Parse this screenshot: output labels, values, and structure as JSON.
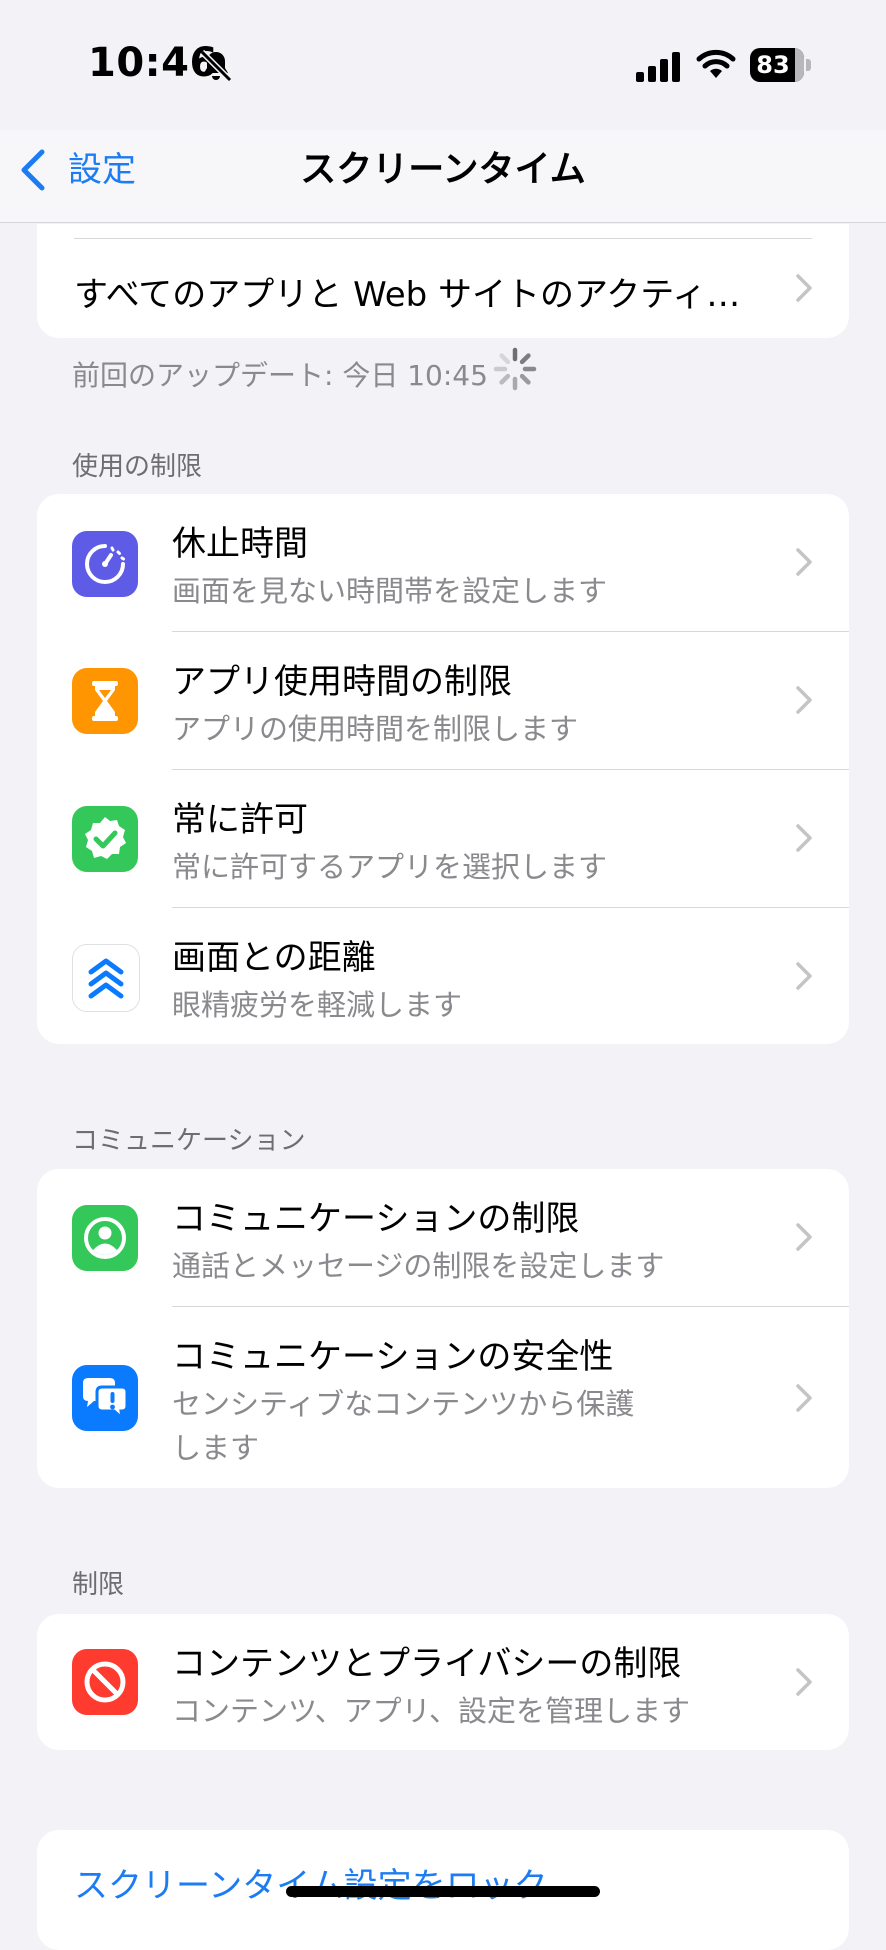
{
  "status_bar": {
    "time": "10:46",
    "battery": "83",
    "icons": [
      "bell-slash-icon",
      "signal-icon",
      "wifi-icon",
      "battery-icon"
    ]
  },
  "nav": {
    "back_label": "設定",
    "title": "スクリーンタイム"
  },
  "activity": {
    "label": "すべてのアプリと Web サイトのアクティ…",
    "update": "前回のアップデート: 今日 10:45"
  },
  "sections": {
    "limits": {
      "header": "使用の制限",
      "items": [
        {
          "title": "休止時間",
          "subtitle": "画面を見ない時間帯を設定します",
          "icon": "downtime-icon",
          "color": "#5E5CE6"
        },
        {
          "title": "アプリ使用時間の制限",
          "subtitle": "アプリの使用時間を制限します",
          "icon": "hourglass-icon",
          "color": "#FF9500"
        },
        {
          "title": "常に許可",
          "subtitle": "常に許可するアプリを選択します",
          "icon": "checkmark-seal-icon",
          "color": "#34C759"
        },
        {
          "title": "画面との距離",
          "subtitle": "眼精疲労を軽減します",
          "icon": "chevrons-up-icon",
          "color": "#FFFFFF"
        }
      ]
    },
    "communication": {
      "header": "コミュニケーション",
      "items": [
        {
          "title": "コミュニケーションの制限",
          "subtitle": "通話とメッセージの制限を設定します",
          "icon": "person-circle-icon",
          "color": "#34C759"
        },
        {
          "title": "コミュニケーションの安全性",
          "subtitle_line1": "センシティブなコンテンツから保護",
          "subtitle_line2": "します",
          "icon": "chat-bubbles-exclamation-icon",
          "color": "#0A7AFF"
        }
      ]
    },
    "restrictions": {
      "header": "制限",
      "items": [
        {
          "title": "コンテンツとプライバシーの制限",
          "subtitle": "コンテンツ、アプリ、設定を管理します",
          "icon": "prohibited-icon",
          "color": "#FF3B30"
        }
      ]
    }
  },
  "lock": {
    "label": "スクリーンタイム設定をロック"
  },
  "colors": {
    "background": "#F2F2F7",
    "accent": "#1C7CF4",
    "secondary_text": "#8A8A8E"
  }
}
